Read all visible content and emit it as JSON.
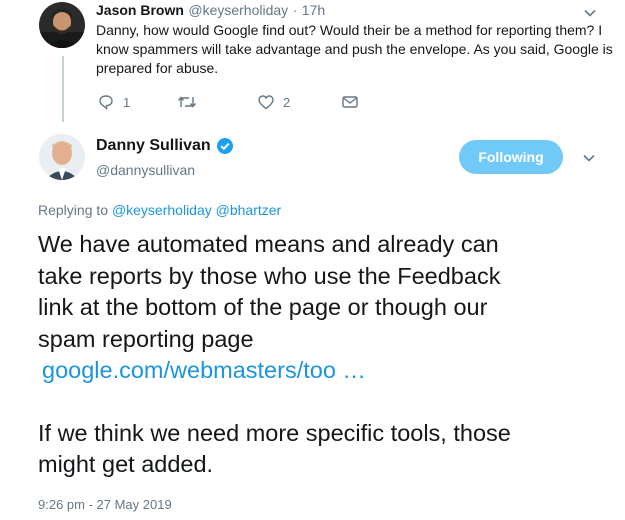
{
  "reply_tweet": {
    "author_name": "Jason Brown",
    "handle": "@keyserholiday",
    "separator": "·",
    "time": "17h",
    "text": "Danny, how would Google find out? Would their be a method for reporting them? I know spammers will take advantage and push the envelope. As you said, Google is prepared for abuse.",
    "reply_count": "1",
    "like_count": "2"
  },
  "main_tweet": {
    "author_name": "Danny Sullivan",
    "handle": "@dannysullivan",
    "follow_label": "Following",
    "replying_to_label": "Replying to",
    "replying_to_handles": [
      "@keyserholiday",
      "@bhartzer"
    ],
    "text_lines": [
      "We have automated means and already can",
      "take reports by those who use the Feedback",
      "link at the bottom of the page or though our",
      "spam reporting page"
    ],
    "link_text": "google.com/webmasters/too …",
    "text_after_lines": [
      "If we think we need more specific tools, those",
      "might get added."
    ],
    "timestamp": "9:26 pm - 27 May 2019"
  },
  "colors": {
    "link": "#1b95e0",
    "follow_button": "#71c9f8",
    "verified_badge": "#1da1f2",
    "muted": "#657786"
  },
  "icons": [
    "reply-icon",
    "retweet-icon",
    "like-icon",
    "message-icon",
    "chevron-down-icon",
    "verified-badge-icon"
  ]
}
